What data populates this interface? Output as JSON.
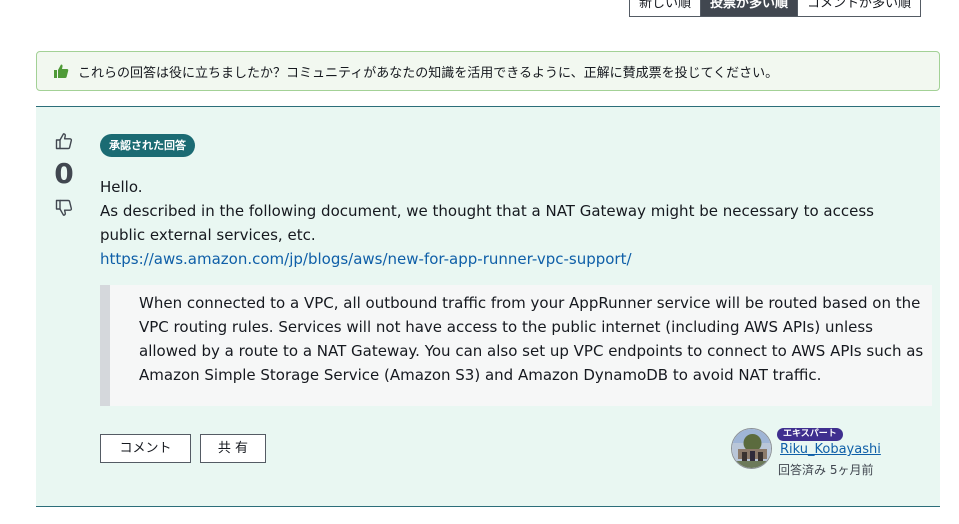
{
  "sort_tabs": [
    {
      "label": "新しい順",
      "active": false
    },
    {
      "label": "投票が多い順",
      "active": true
    },
    {
      "label": "コメントが多い順",
      "active": false
    }
  ],
  "banner": {
    "icon": "thumbs-up-icon",
    "text": "これらの回答は役に立ちましたか？コミュニティがあなたの知識を活用できるように、正解に賛成票を投じてください。"
  },
  "answer": {
    "vote_count": "0",
    "accepted_label": "承認された回答",
    "body_lines": [
      "Hello.",
      "As described in the following document, we thought that a NAT Gateway might be necessary to access public external services, etc."
    ],
    "link": "https://aws.amazon.com/jp/blogs/aws/new-for-app-runner-vpc-support/",
    "quote": "When connected to a VPC, all outbound traffic from your AppRunner service will be routed based on the VPC routing rules. Services will not have access to the public internet (including AWS APIs) unless allowed by a route to a NAT Gateway. You can also set up VPC endpoints to connect to AWS APIs such as Amazon Simple Storage Service (Amazon S3) and Amazon DynamoDB to avoid NAT traffic.",
    "actions": {
      "comment_label": "コメント",
      "share_label": "共 有"
    },
    "author": {
      "expert_badge": "エキスパート",
      "name": "Riku_Kobayashi",
      "answered": "回答済み 5ヶ月前"
    }
  },
  "colors": {
    "accent_teal": "#1b6b73",
    "answer_bg": "#e9f7f2",
    "banner_bg": "#f2f8f0",
    "link": "#0f5fa8",
    "expert_purple": "#3f2f8f"
  }
}
